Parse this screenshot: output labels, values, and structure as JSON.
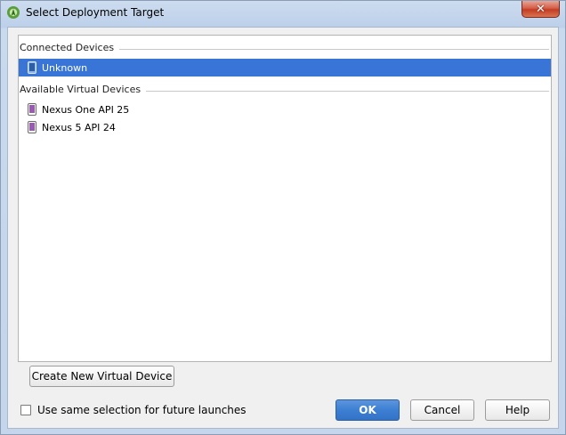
{
  "window": {
    "title": "Select Deployment Target",
    "close_glyph": "✕"
  },
  "device_list": {
    "connected_header": "Connected Devices",
    "connected": [
      {
        "label": "Unknown",
        "icon": "phone-icon",
        "selected": true
      }
    ],
    "available_header": "Available Virtual Devices",
    "available": [
      {
        "label": "Nexus One API 25",
        "icon": "avd-phone-icon"
      },
      {
        "label": "Nexus 5 API 24",
        "icon": "avd-phone-icon"
      }
    ]
  },
  "buttons": {
    "create_new": "Create New Virtual Device",
    "ok": "OK",
    "cancel": "Cancel",
    "help": "Help"
  },
  "options": {
    "use_same_selection": "Use same selection for future launches",
    "use_same_selection_checked": false
  },
  "colors": {
    "selection": "#3875d7",
    "primary_button": "#3d7fd3",
    "close_button": "#c33c23",
    "avd_icon": "#9b59b6"
  }
}
